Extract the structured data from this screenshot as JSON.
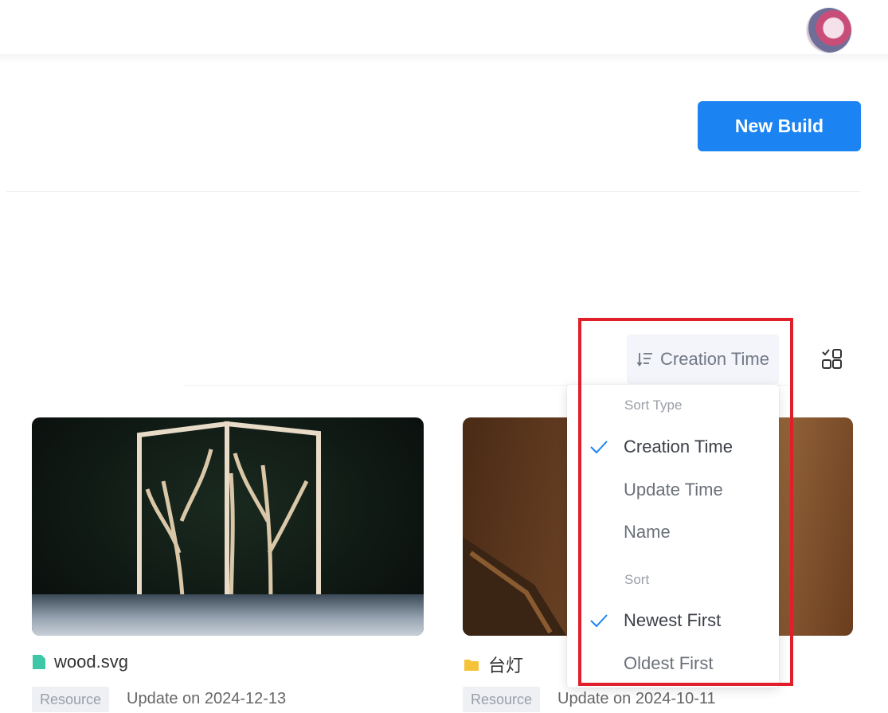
{
  "header": {
    "avatar_alt": "user avatar"
  },
  "toolbar": {
    "new_build_label": "New Build"
  },
  "sort": {
    "trigger_label": "Creation Time",
    "group_type_label": "Sort Type",
    "type_options": [
      {
        "label": "Creation Time",
        "checked": true
      },
      {
        "label": "Update Time",
        "checked": false
      },
      {
        "label": "Name",
        "checked": false
      }
    ],
    "group_order_label": "Sort",
    "order_options": [
      {
        "label": "Newest First",
        "checked": true
      },
      {
        "label": "Oldest First",
        "checked": false
      }
    ]
  },
  "cards": [
    {
      "name": "wood.svg",
      "icon": "file-icon",
      "tag": "Resource",
      "updated": "Update on 2024-12-13"
    },
    {
      "name": "台灯",
      "icon": "folder-icon",
      "tag": "Resource",
      "updated": "Update on 2024-10-11"
    }
  ],
  "colors": {
    "primary": "#1b84f2",
    "highlight": "#e01f2a",
    "check": "#1b84f2"
  }
}
